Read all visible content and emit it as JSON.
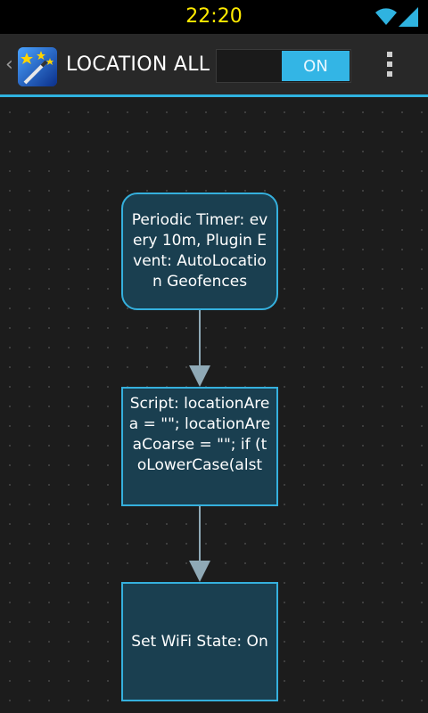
{
  "status_bar": {
    "time": "22:20",
    "icons": [
      "wifi-icon",
      "cell-signal-icon"
    ]
  },
  "action_bar": {
    "title": "LOCATION ALL",
    "toggle_label": "ON",
    "icons": [
      "up-caret-icon",
      "app-icon",
      "overflow-menu-icon"
    ]
  },
  "flow": {
    "nodes": [
      {
        "kind": "trigger",
        "text": "Periodic Timer: every 10m, Plugin Event: AutoLocation Geofences"
      },
      {
        "kind": "action",
        "text": "Script: locationArea = \"\"; locationAreaCoarse = \"\"; if (toLowerCase(alst"
      },
      {
        "kind": "action",
        "text": "Set WiFi State: On"
      }
    ]
  },
  "colors": {
    "accent": "#33b5e5",
    "node_fill": "#1a3f50",
    "connector": "#8fa9b6",
    "clock": "#ffea00"
  }
}
